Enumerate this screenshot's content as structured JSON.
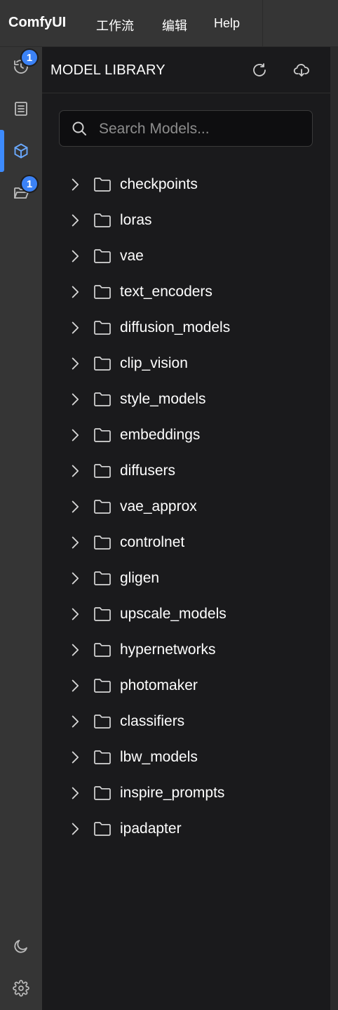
{
  "app": {
    "brand": "ComfyUI",
    "menu": [
      "工作流",
      "编辑",
      "Help"
    ]
  },
  "rail": {
    "history_badge": "1",
    "files_badge": "1",
    "accent_color": "#3b82f6"
  },
  "panel": {
    "title": "MODEL LIBRARY",
    "search": {
      "placeholder": "Search Models...",
      "value": ""
    },
    "folders": [
      "checkpoints",
      "loras",
      "vae",
      "text_encoders",
      "diffusion_models",
      "clip_vision",
      "style_models",
      "embeddings",
      "diffusers",
      "vae_approx",
      "controlnet",
      "gligen",
      "upscale_models",
      "hypernetworks",
      "photomaker",
      "classifiers",
      "lbw_models",
      "inspire_prompts",
      "ipadapter"
    ]
  }
}
